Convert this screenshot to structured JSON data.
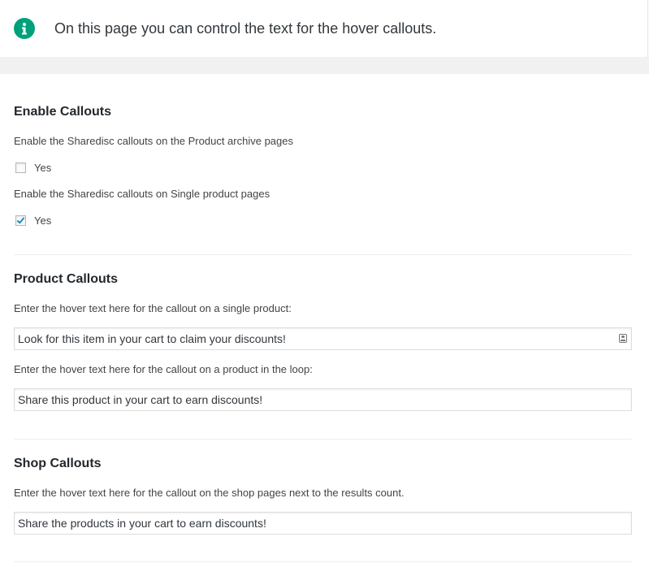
{
  "notice": {
    "icon": "info-icon",
    "icon_color": "#00a07c",
    "text": "On this page you can control the text for the hover callouts."
  },
  "enable_callouts": {
    "title": "Enable Callouts",
    "archive_desc": "Enable the Sharedisc callouts on the Product archive pages",
    "archive_label": "Yes",
    "archive_checked": false,
    "single_desc": "Enable the Sharedisc callouts on Single product pages",
    "single_label": "Yes",
    "single_checked": true
  },
  "product_callouts": {
    "title": "Product Callouts",
    "single_desc": "Enter the hover text here for the callout on a single product:",
    "single_value": "Look for this item in your cart to claim your discounts!",
    "loop_desc": "Enter the hover text here for the callout on a product in the loop:",
    "loop_value": "Share this product in your cart to earn discounts!"
  },
  "shop_callouts": {
    "title": "Shop Callouts",
    "desc": "Enter the hover text here for the callout on the shop pages next to the results count.",
    "value": "Share the products in your cart to earn discounts!"
  }
}
